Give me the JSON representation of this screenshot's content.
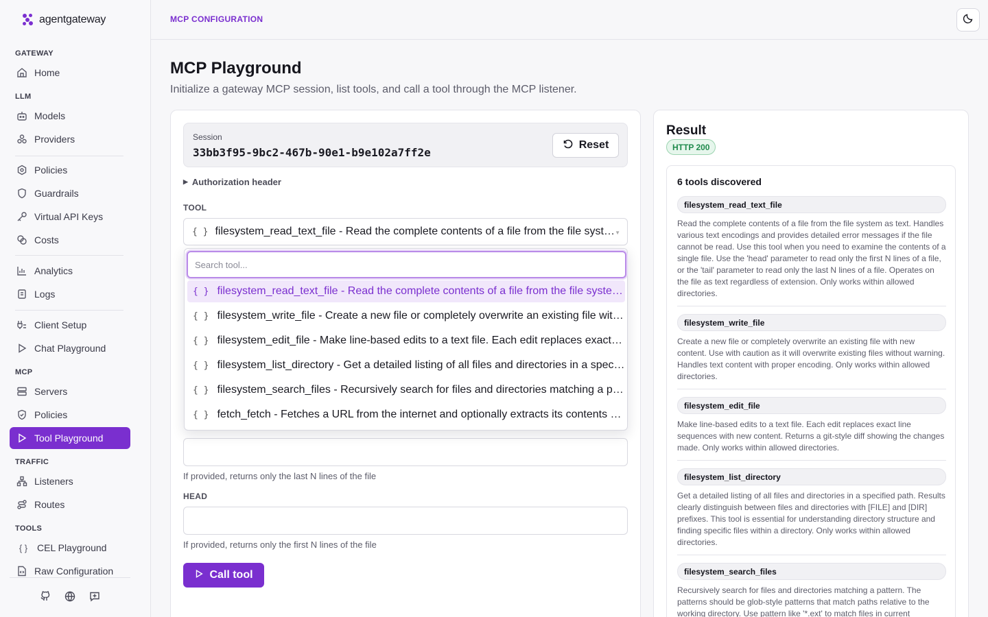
{
  "app": {
    "name": "agentgateway"
  },
  "sidebar": {
    "sections": {
      "gateway": "GATEWAY",
      "llm": "LLM",
      "mcp": "MCP",
      "traffic": "TRAFFIC",
      "tools": "TOOLS"
    },
    "items": {
      "home": "Home",
      "models": "Models",
      "providers": "Providers",
      "policies": "Policies",
      "guardrails": "Guardrails",
      "virtual_keys": "Virtual API Keys",
      "costs": "Costs",
      "analytics": "Analytics",
      "logs": "Logs",
      "client_setup": "Client Setup",
      "chat_playground": "Chat Playground",
      "servers": "Servers",
      "mcp_policies": "Policies",
      "tool_playground": "Tool Playground",
      "listeners": "Listeners",
      "routes": "Routes",
      "cel_playground": "CEL Playground",
      "raw_config": "Raw Configuration"
    },
    "active": "tool_playground"
  },
  "header": {
    "breadcrumb": "MCP CONFIGURATION"
  },
  "page": {
    "title": "MCP Playground",
    "subtitle": "Initialize a gateway MCP session, list tools, and call a tool through the MCP listener."
  },
  "session": {
    "label": "Session",
    "id": "33bb3f95-9bc2-467b-90e1-b9e102a7ff2e",
    "reset_label": "Reset",
    "auth_label": "Authorization header"
  },
  "tool": {
    "label": "TOOL",
    "selected": "filesystem_read_text_file - Read the complete contents of a file from the file system as text.",
    "search_placeholder": "Search tool...",
    "options": [
      "filesystem_read_text_file - Read the complete contents of a file from the file system as text.",
      "filesystem_write_file - Create a new file or completely overwrite an existing file with new content.",
      "filesystem_edit_file - Make line-based edits to a text file. Each edit replaces exact line sequences.",
      "filesystem_list_directory - Get a detailed listing of all files and directories in a specified path.",
      "filesystem_search_files - Recursively search for files and directories matching a pattern.",
      "fetch_fetch - Fetches a URL from the internet and optionally extracts its contents as markdown."
    ]
  },
  "params": {
    "tail_help": "If provided, returns only the last N lines of the file",
    "head_label": "HEAD",
    "head_help": "If provided, returns only the first N lines of the file"
  },
  "call_label": "Call tool",
  "result": {
    "title": "Result",
    "status": "HTTP 200",
    "count": "6 tools discovered",
    "tools": [
      {
        "name": "filesystem_read_text_file",
        "desc": "Read the complete contents of a file from the file system as text. Handles various text encodings and provides detailed error messages if the file cannot be read. Use this tool when you need to examine the contents of a single file. Use the 'head' parameter to read only the first N lines of a file, or the 'tail' parameter to read only the last N lines of a file. Operates on the file as text regardless of extension. Only works within allowed directories."
      },
      {
        "name": "filesystem_write_file",
        "desc": "Create a new file or completely overwrite an existing file with new content. Use with caution as it will overwrite existing files without warning. Handles text content with proper encoding. Only works within allowed directories."
      },
      {
        "name": "filesystem_edit_file",
        "desc": "Make line-based edits to a text file. Each edit replaces exact line sequences with new content. Returns a git-style diff showing the changes made. Only works within allowed directories."
      },
      {
        "name": "filesystem_list_directory",
        "desc": "Get a detailed listing of all files and directories in a specified path. Results clearly distinguish between files and directories with [FILE] and [DIR] prefixes. This tool is essential for understanding directory structure and finding specific files within a directory. Only works within allowed directories."
      },
      {
        "name": "filesystem_search_files",
        "desc": "Recursively search for files and directories matching a pattern. The patterns should be glob-style patterns that match paths relative to the working directory. Use pattern like '*.ext' to match files in current"
      }
    ]
  },
  "colors": {
    "accent": "#7a2fcf",
    "success": "#1f8a4c"
  }
}
